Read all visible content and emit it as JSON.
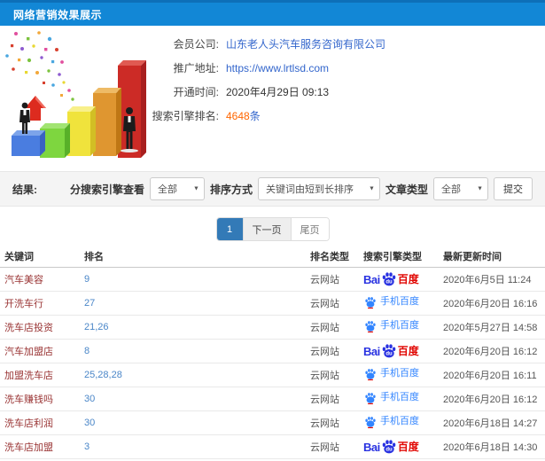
{
  "header": {
    "title": "网络营销效果展示"
  },
  "info": {
    "fields": [
      {
        "label": "会员公司:",
        "value": "山东老人头汽车服务咨询有限公司"
      },
      {
        "label": "推广地址:",
        "value": "https://www.lrtlsd.com"
      },
      {
        "label": "开通时间:",
        "value": "2020年4月29日 09:13"
      },
      {
        "label": "搜索引擎排名:",
        "value": "4648",
        "suffix": "条"
      }
    ]
  },
  "filters": {
    "result_label": "结果:",
    "engine_label": "分搜索引擎查看",
    "engine_value": "全部",
    "sort_label": "排序方式",
    "sort_value": "关键词由短到长排序",
    "article_label": "文章类型",
    "article_value": "全部",
    "submit_label": "提交"
  },
  "pagination": {
    "current": "1",
    "next": "下一页",
    "last": "尾页"
  },
  "table": {
    "headers": [
      "关键词",
      "排名",
      "排名类型",
      "搜索引擎类型",
      "最新更新时间"
    ],
    "rows": [
      {
        "keyword": "汽车美容",
        "rank": "9",
        "rank_type": "云网站",
        "engine": "baidu",
        "updated": "2020年6月5日 11:24"
      },
      {
        "keyword": "开洗车行",
        "rank": "27",
        "rank_type": "云网站",
        "engine": "mobile",
        "updated": "2020年6月20日 16:16"
      },
      {
        "keyword": "洗车店投资",
        "rank": "21,26",
        "rank_type": "云网站",
        "engine": "mobile",
        "updated": "2020年5月27日 14:58"
      },
      {
        "keyword": "汽车加盟店",
        "rank": "8",
        "rank_type": "云网站",
        "engine": "baidu",
        "updated": "2020年6月20日 16:12"
      },
      {
        "keyword": "加盟洗车店",
        "rank": "25,28,28",
        "rank_type": "云网站",
        "engine": "mobile",
        "updated": "2020年6月20日 16:11"
      },
      {
        "keyword": "洗车赚钱吗",
        "rank": "30",
        "rank_type": "云网站",
        "engine": "mobile",
        "updated": "2020年6月20日 16:12"
      },
      {
        "keyword": "洗车店利润",
        "rank": "30",
        "rank_type": "云网站",
        "engine": "mobile",
        "updated": "2020年6月18日 14:27"
      },
      {
        "keyword": "洗车店加盟",
        "rank": "3",
        "rank_type": "云网站",
        "engine": "baidu",
        "updated": "2020年6月18日 14:30"
      }
    ]
  },
  "engines": {
    "baidu": {
      "prefix": "Bai",
      "du": "du",
      "suffix": "百度"
    },
    "mobile": {
      "label": "手机百度"
    }
  },
  "colors": {
    "header": "#1287d6",
    "accent": "#337ab7",
    "link": "#3366cc",
    "orange": "#ff6600",
    "keyword": "#993333",
    "baidu_blue": "#2932e1",
    "baidu_red": "#e10602",
    "mobile_blue": "#3385ff"
  }
}
